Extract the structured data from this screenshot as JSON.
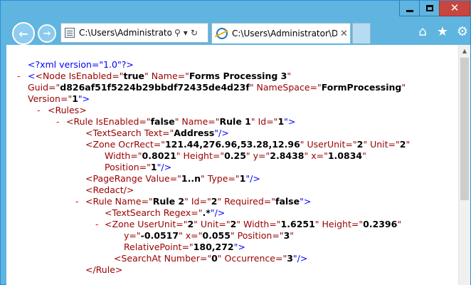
{
  "window": {
    "minimize_label": "▁",
    "maximize_label": "□",
    "close_label": "✕"
  },
  "nav": {
    "back_label": "←",
    "forward_label": "→",
    "address": "C:\\Users\\Administrator\\",
    "search_icon": "⚲",
    "dropdown_icon": "▾",
    "refresh_icon": "↻"
  },
  "tab": {
    "title": "C:\\Users\\Administrator\\Do...",
    "close_label": "✕"
  },
  "toolbar": {
    "home_icon": "⌂",
    "favorites_icon": "★",
    "settings_icon": "⚙"
  },
  "xml": {
    "decl": "<?xml version=\"1.0\"?>",
    "node_open": "<Node",
    "node_a1": "IsEnabled=\"",
    "node_v1": "true",
    "node_a2": "\" Name=\"",
    "node_v2": "Forms Processing 3",
    "node_a3": "\"",
    "guid_a": "Guid=\"",
    "guid_v": "d826af51f5224b29bbdf72435de4d23f",
    "ns_a": "\" NameSpace=\"",
    "ns_v": "FormProcessing",
    "ns_end": "\"",
    "ver_a": "Version=\"",
    "ver_v": "1",
    "ver_end": "\">",
    "rules_open": "<Rules>",
    "rule1_open": "<Rule",
    "rule1_a1": "IsEnabled=\"",
    "rule1_v1": "false",
    "rule1_a2": "\" Name=\"",
    "rule1_v2": "Rule 1",
    "rule1_a3": "\" Id=\"",
    "rule1_v3": "1",
    "rule1_end": "\">",
    "ts1_open": "<TextSearch",
    "ts1_a": "Text=\"",
    "ts1_v": "Address",
    "ts1_end": "\"/>",
    "z1_open": "<Zone",
    "z1_a1": "OcrRect=\"",
    "z1_v1": "121.44,276.96,53.28,12.96",
    "z1_a2": "\" UserUnit=\"",
    "z1_v2": "2",
    "z1_a3": "\" Unit=\"",
    "z1_v3": "2",
    "z1_q": "\"",
    "z1_a4": "Width=\"",
    "z1_v4": "0.8021",
    "z1_a5": "\" Height=\"",
    "z1_v5": "0.25",
    "z1_a6": "\" y=\"",
    "z1_v6": "2.8438",
    "z1_a7": "\" x=\"",
    "z1_v7": "1.0834",
    "z1_q2": "\"",
    "z1_a8": "Position=\"",
    "z1_v8": "1",
    "z1_end": "\"/>",
    "pr_open": "<PageRange",
    "pr_a1": "Value=\"",
    "pr_v1": "1..n",
    "pr_a2": "\" Type=\"",
    "pr_v2": "1",
    "pr_end": "\"/>",
    "redact": "<Redact/>",
    "rule2_open": "<Rule",
    "rule2_a1": "Name=\"",
    "rule2_v1": "Rule 2",
    "rule2_a2": "\" Id=\"",
    "rule2_v2": "2",
    "rule2_a3": "\" Required=\"",
    "rule2_v3": "false",
    "rule2_end": "\">",
    "ts2_open": "<TextSearch",
    "ts2_a": "Regex=\"",
    "ts2_v": ".*",
    "ts2_end": "\"/>",
    "z2_open": "<Zone",
    "z2_a1": "UserUnit=\"",
    "z2_v1": "2",
    "z2_a2": "\" Unit=\"",
    "z2_v2": "2",
    "z2_a3": "\" Width=\"",
    "z2_v3": "1.6251",
    "z2_a4": "\" Height=\"",
    "z2_v4": "0.2396",
    "z2_q": "\"",
    "z2_a5": "y=\"",
    "z2_v5": "-0.0517",
    "z2_a6": "\" x=\"",
    "z2_v6": "0.055",
    "z2_a7": "\" Position=\"",
    "z2_v7": "3",
    "z2_q2": "\"",
    "z2_a8": "RelativePoint=\"",
    "z2_v8": "180,272",
    "z2_end": "\">",
    "sa_open": "<SearchAt",
    "sa_a1": "Number=\"",
    "sa_v1": "0",
    "sa_a2": "\" Occurrence=\"",
    "sa_v2": "3",
    "sa_end": "\"/>",
    "rule_close": "</Rule>",
    "collapse_marker": "-"
  }
}
